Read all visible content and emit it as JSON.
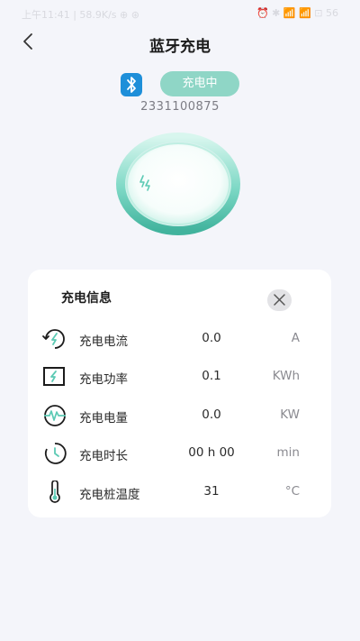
{
  "status_bar": {
    "left": "上午11:41 | 58.9K/s ⊕ ⊛",
    "right": "⏰ ✱ 📶 📶 ⊡ 56"
  },
  "header": {
    "title": "蓝牙充电",
    "back_icon": "chevron-left-icon"
  },
  "device": {
    "bluetooth_icon": "bluetooth-icon",
    "status": "充电中",
    "id": "2331100875"
  },
  "colors": {
    "accent": "#5ccab4",
    "pill": "#8fd6c6",
    "bluetooth": "#1e8fd9",
    "background": "#f4f5fa"
  },
  "info": {
    "title": "充电信息",
    "close_icon": "close-icon",
    "rows": [
      {
        "icon": "current-icon",
        "label": "充电电流",
        "value": "0.0",
        "unit": "A"
      },
      {
        "icon": "power-icon",
        "label": "充电功率",
        "value": "0.1",
        "unit": "KWh"
      },
      {
        "icon": "energy-icon",
        "label": "充电电量",
        "value": "0.0",
        "unit": "KW"
      },
      {
        "icon": "clock-icon",
        "label": "充电时长",
        "value": "00 h 00",
        "unit": "min"
      },
      {
        "icon": "thermometer-icon",
        "label": "充电桩温度",
        "value": "31",
        "unit": "°C"
      }
    ]
  }
}
